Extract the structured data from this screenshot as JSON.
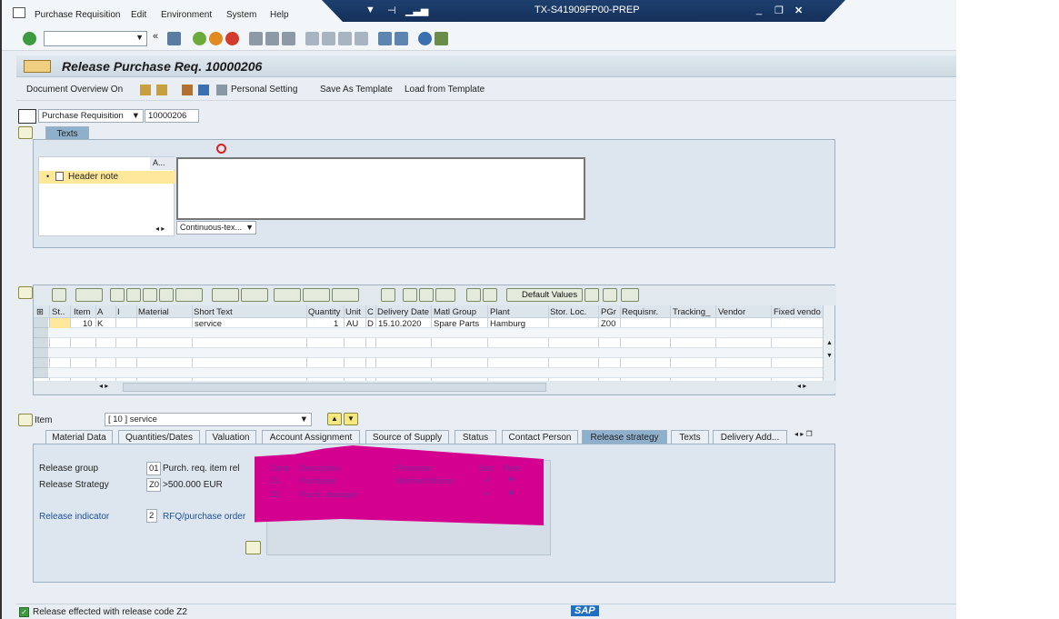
{
  "menubar": {
    "items": [
      "Purchase Requisition",
      "Edit",
      "Environment",
      "System",
      "Help"
    ]
  },
  "title_banner": {
    "system": "TX-S41909FP00-PREP"
  },
  "page_title": "Release Purchase Req. 10000206",
  "app_toolbar": {
    "document_overview": "Document Overview On",
    "personal_setting": "Personal Setting",
    "save_as_template": "Save As Template",
    "load_from_template": "Load from Template"
  },
  "doc_selector": {
    "type": "Purchase Requisition",
    "number": "10000206"
  },
  "texts_panel": {
    "tab_label": "Texts",
    "tree_column": "A...",
    "tree_item": "Header note",
    "format_select": "Continuous-tex..."
  },
  "grid": {
    "default_values": "Default Values",
    "columns": [
      "St..",
      "Item",
      "A",
      "I",
      "Material",
      "Short Text",
      "Quantity",
      "Unit",
      "C",
      "Delivery Date",
      "Matl Group",
      "Plant",
      "Stor. Loc.",
      "PGr",
      "Requisnr.",
      "Tracking_",
      "Vendor",
      "Fixed vendo"
    ],
    "rows": [
      {
        "item": "10",
        "a": "K",
        "short_text": "service",
        "quantity": "1",
        "unit": "AU",
        "c": "D",
        "delivery_date": "15.10.2020",
        "matl_group": "Spare Parts",
        "plant": "Hamburg",
        "pgr": "Z00"
      }
    ]
  },
  "item_detail": {
    "label": "Item",
    "selected_item": "[ 10 ] service",
    "tabs": [
      "Material Data",
      "Quantities/Dates",
      "Valuation",
      "Account Assignment",
      "Source of Supply",
      "Status",
      "Contact Person",
      "Release strategy",
      "Texts",
      "Delivery Add..."
    ],
    "active_tab": "Release strategy"
  },
  "release_strategy": {
    "release_group_label": "Release group",
    "release_group_code": "01",
    "release_group_value": "Purch. req. item rel",
    "release_strategy_label": "Release Strategy",
    "release_strategy_code": "Z0",
    "release_strategy_value": ">500.000 EUR",
    "release_indicator_label": "Release indicator",
    "release_indicator_code": "2",
    "release_indicator_value": "RFQ/purchase order",
    "table_headers": [
      "Code",
      "Description",
      "Processor",
      "Stat",
      "Rele"
    ],
    "table_rows": [
      {
        "code": "Z1",
        "description": "Purchaser",
        "processor": "Winfried Würzer"
      },
      {
        "code": "Z2",
        "description": "Purch. manager",
        "processor": ""
      }
    ],
    "check_glyph": "✔"
  },
  "status": {
    "message": "Release effected with release code Z2",
    "sap_logo": "SAP"
  }
}
